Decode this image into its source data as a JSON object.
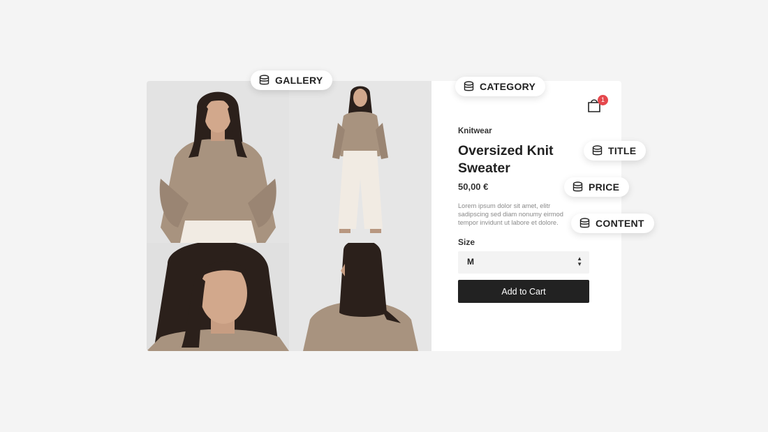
{
  "tags": {
    "gallery": "GALLERY",
    "category": "CATEGORY",
    "title": "TITLE",
    "price": "PRICE",
    "content": "CONTENT"
  },
  "gallery": {
    "photos": [
      {
        "subject": "model-front-waist-up"
      },
      {
        "subject": "model-full-body"
      },
      {
        "subject": "model-face-closeup"
      },
      {
        "subject": "model-back-view"
      }
    ]
  },
  "cart": {
    "icon": "shopping-bag-icon",
    "count": "1",
    "badge_color": "#e5484d"
  },
  "product": {
    "category": "Knitwear",
    "title": "Oversized Knit Sweater",
    "price": "50,00 €",
    "description": "Lorem ipsum dolor sit amet, elitr sadipscing sed diam nonumy eirmod tempor invidunt ut labore et dolore.",
    "size_label": "Size",
    "size_value": "M",
    "add_to_cart": "Add to Cart"
  },
  "colors": {
    "background": "#f4f4f4",
    "card": "#ffffff",
    "button": "#222222",
    "sweater": "#a8937f",
    "photo_bg": "#e6e6e6"
  }
}
